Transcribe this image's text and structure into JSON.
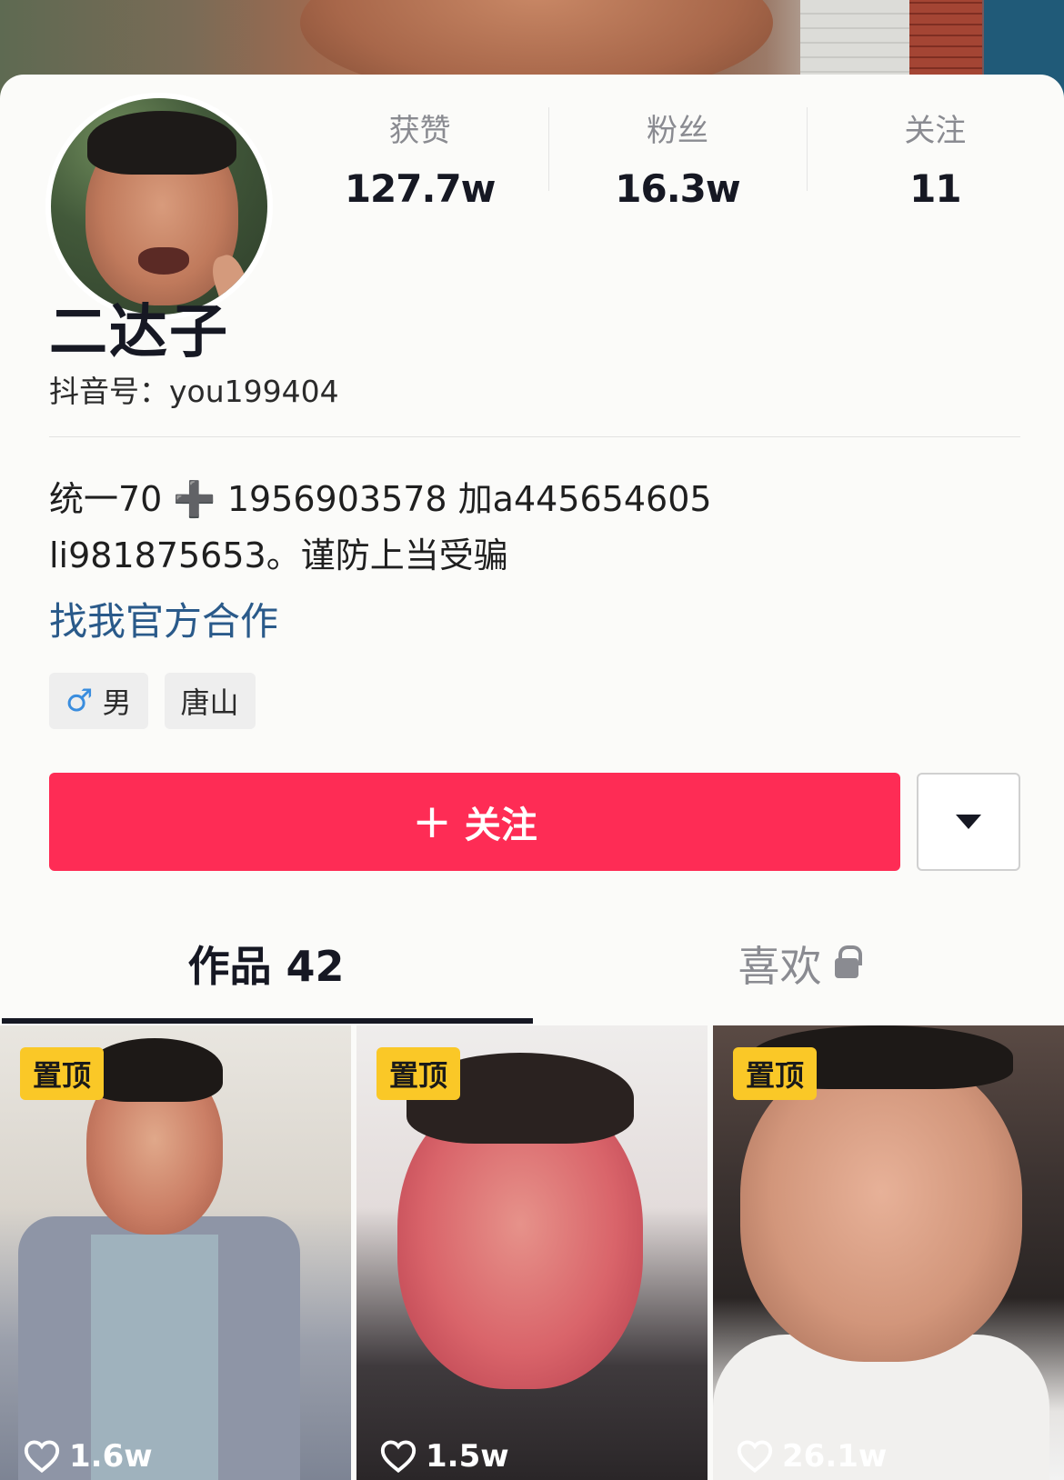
{
  "profile": {
    "nickname": "二达子",
    "douyin_id": "抖音号：you199404",
    "bio_line1": "统一70 ➕ 1956903578 加a445654605",
    "bio_line2": "li981875653。谨防上当受骗",
    "official_link": "找我官方合作",
    "tags": {
      "gender_icon": "♂",
      "gender": "男",
      "location": "唐山"
    }
  },
  "stats": [
    {
      "label": "获赞",
      "value": "127.7w"
    },
    {
      "label": "粉丝",
      "value": "16.3w"
    },
    {
      "label": "关注",
      "value": "11"
    }
  ],
  "actions": {
    "follow_plus": "+",
    "follow_label": "关注",
    "more_icon": "caret-down-icon"
  },
  "tabs": [
    {
      "label": "作品 42",
      "active": true
    },
    {
      "label": "喜欢",
      "active": false,
      "icon": "lock-icon"
    }
  ],
  "videos": [
    {
      "badge": "置顶",
      "likes": "1.6w"
    },
    {
      "badge": "置顶",
      "likes": "1.5w"
    },
    {
      "badge": "置顶",
      "likes": "26.1w"
    }
  ],
  "colors": {
    "accent": "#fe2c55",
    "link": "#2a5a8a",
    "pin_badge": "#fac827"
  }
}
